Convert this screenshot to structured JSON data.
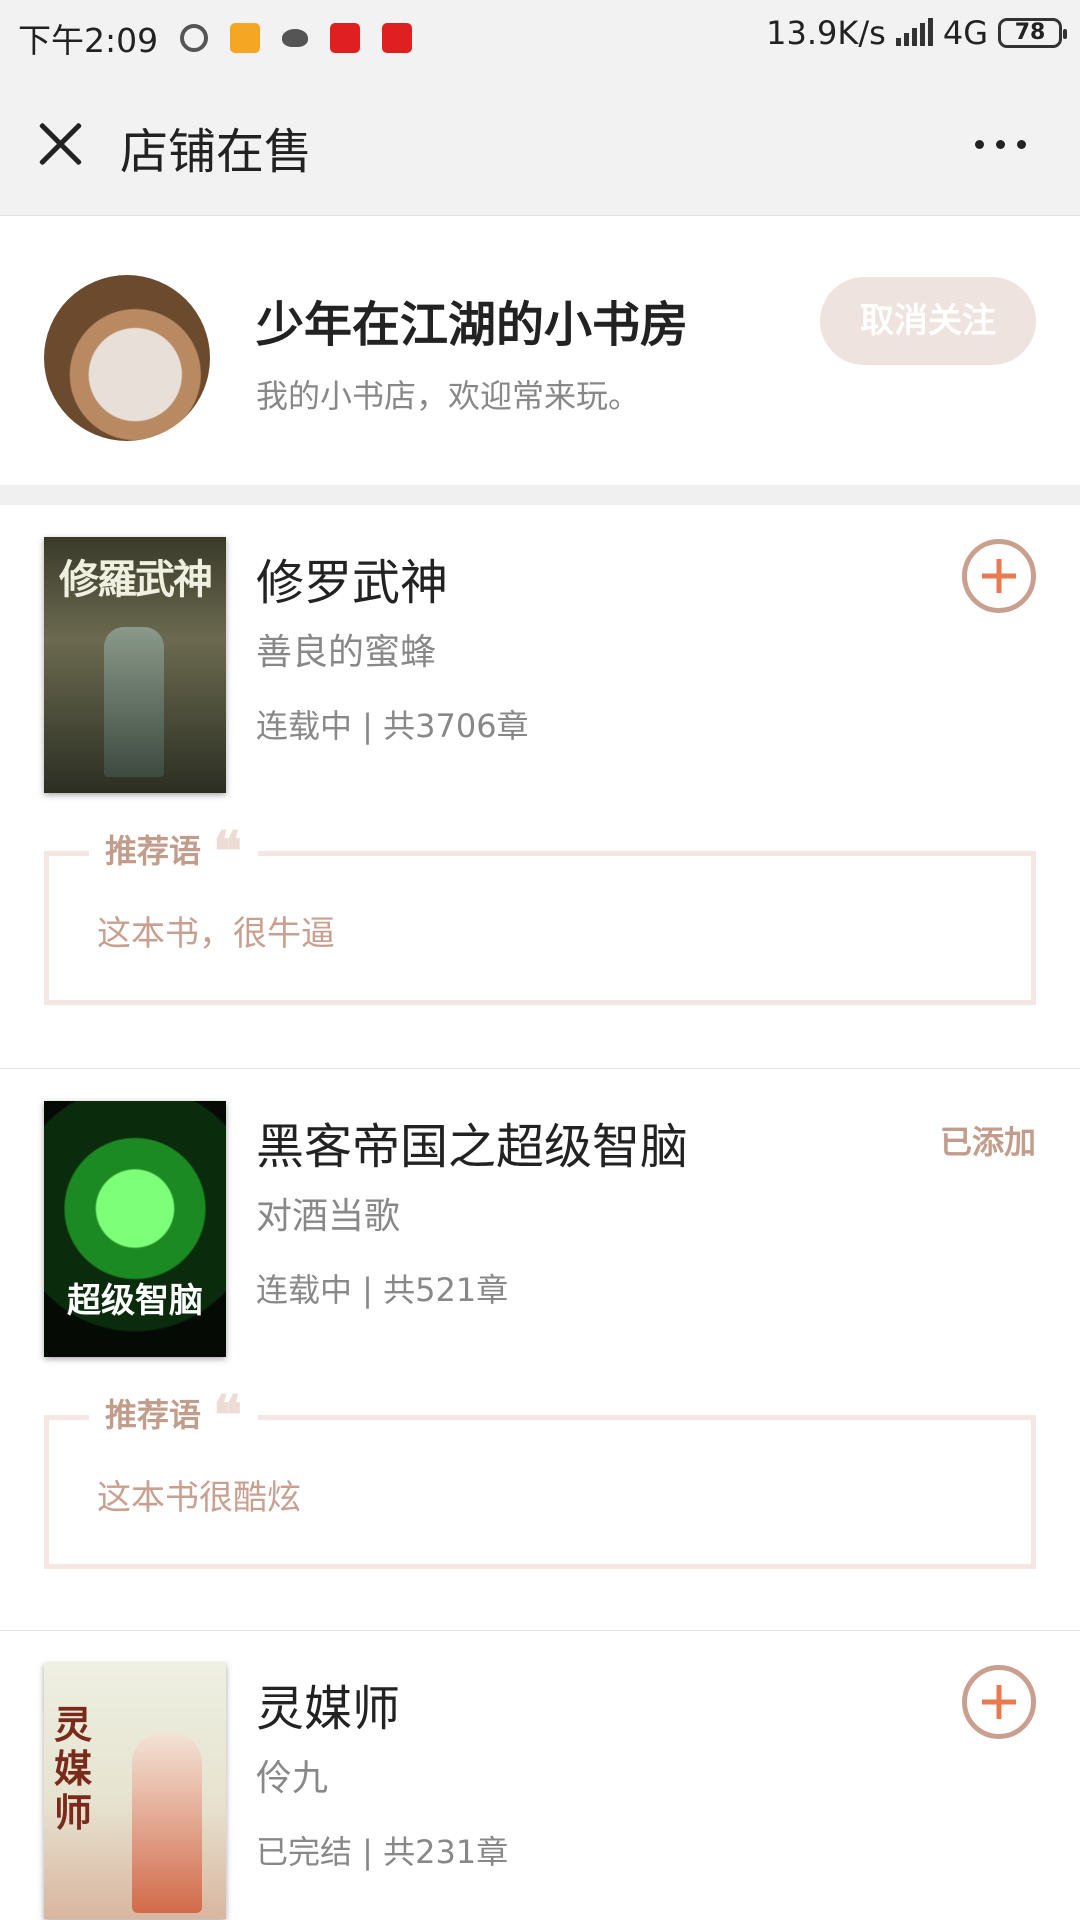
{
  "status_bar": {
    "time": "下午2:09",
    "speed": "13.9K/s",
    "network": "4G",
    "battery": "78",
    "icons": [
      "spiral-icon",
      "free-app-icon",
      "bird-icon",
      "tiger-app-icon",
      "tiger-app-icon"
    ]
  },
  "header": {
    "title": "店铺在售",
    "close_icon": "close-icon",
    "more_icon": "more-icon"
  },
  "shop": {
    "name": "少年在江湖的小书房",
    "description": "我的小书店，欢迎常来玩。",
    "unfollow_label": "取消关注"
  },
  "books": [
    {
      "title": "修罗武神",
      "author": "善良的蜜蜂",
      "meta": "连载中 | 共3706章",
      "cover_text": "修羅武神",
      "status": "add",
      "rec_label": "推荐语",
      "rec_text": "这本书，很牛逼"
    },
    {
      "title": "黑客帝国之超级智脑",
      "author": "对酒当歌",
      "meta": "连载中 | 共521章",
      "cover_text": "超级智脑",
      "status": "added",
      "added_label": "已添加",
      "rec_label": "推荐语",
      "rec_text": "这本书很酷炫"
    },
    {
      "title": "灵媒师",
      "author": "伶九",
      "meta": "已完结 | 共231章",
      "cover_text": "灵媒师",
      "status": "add"
    }
  ],
  "colors": {
    "accent": "#e87a50",
    "muted_accent": "#c39d8b",
    "unfollow_bg": "#efe3df"
  }
}
